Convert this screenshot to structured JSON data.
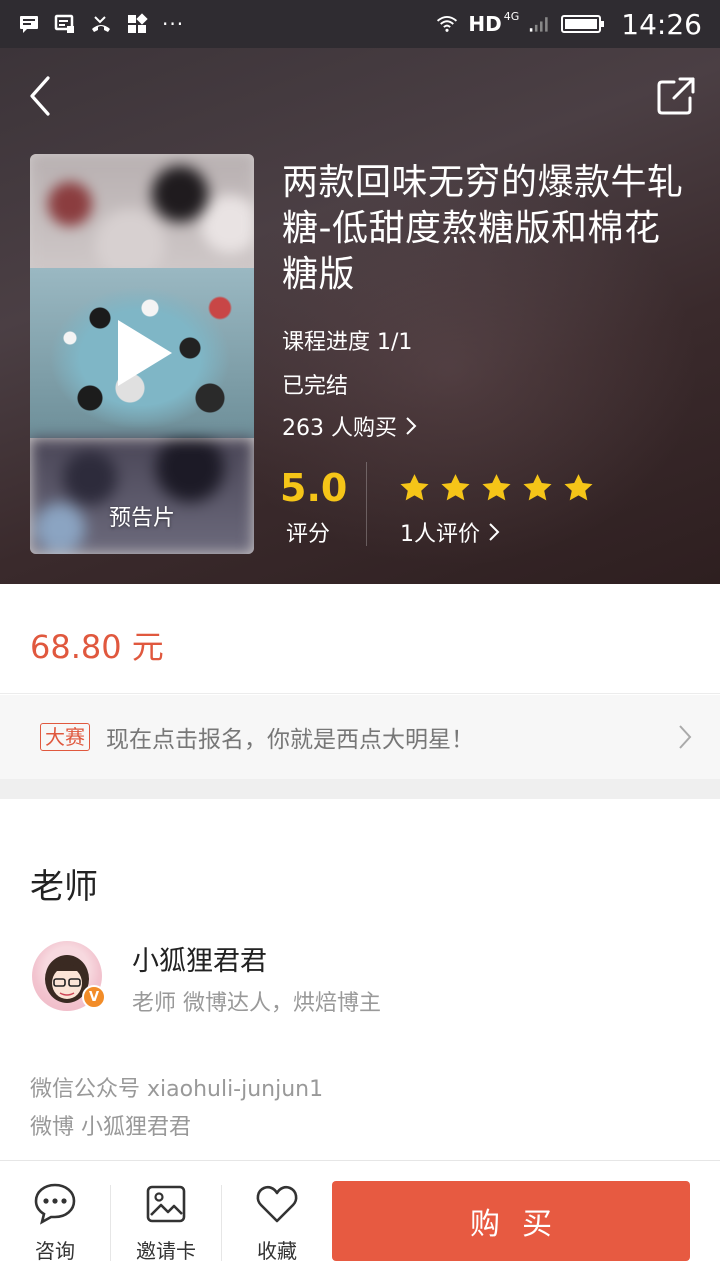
{
  "status_bar": {
    "network": "HD",
    "network_sub": "4G",
    "time": "14:26",
    "overflow": "···"
  },
  "header": {
    "back_icon": "chevron-left-icon",
    "share_icon": "share-icon"
  },
  "course": {
    "title": "两款回味无穷的爆款牛轧糖-低甜度熬糖版和棉花糖版",
    "cover_label": "预告片",
    "progress": "课程进度 1/1",
    "status": "已完结",
    "buyers": "263 人购买",
    "score": "5.0",
    "score_label": "评分",
    "stars": 5,
    "reviews": "1人评价",
    "accent_color": "#f5c518"
  },
  "price": {
    "amount": "68.80 元",
    "color": "#e0583e"
  },
  "contest": {
    "badge": "大赛",
    "text": "现在点击报名，你就是西点大明星！"
  },
  "teacher": {
    "heading": "老师",
    "name": "小狐狸君君",
    "title": "老师 微博达人，烘焙博主",
    "verified_badge": "V",
    "wechat": "微信公众号 xiaohuli-junjun1",
    "weibo": "微博 小狐狸君君"
  },
  "bottom_bar": {
    "consult_label": "咨询",
    "invite_label": "邀请卡",
    "favorite_label": "收藏",
    "buy_label": "购买",
    "buy_color": "#e75a41"
  }
}
